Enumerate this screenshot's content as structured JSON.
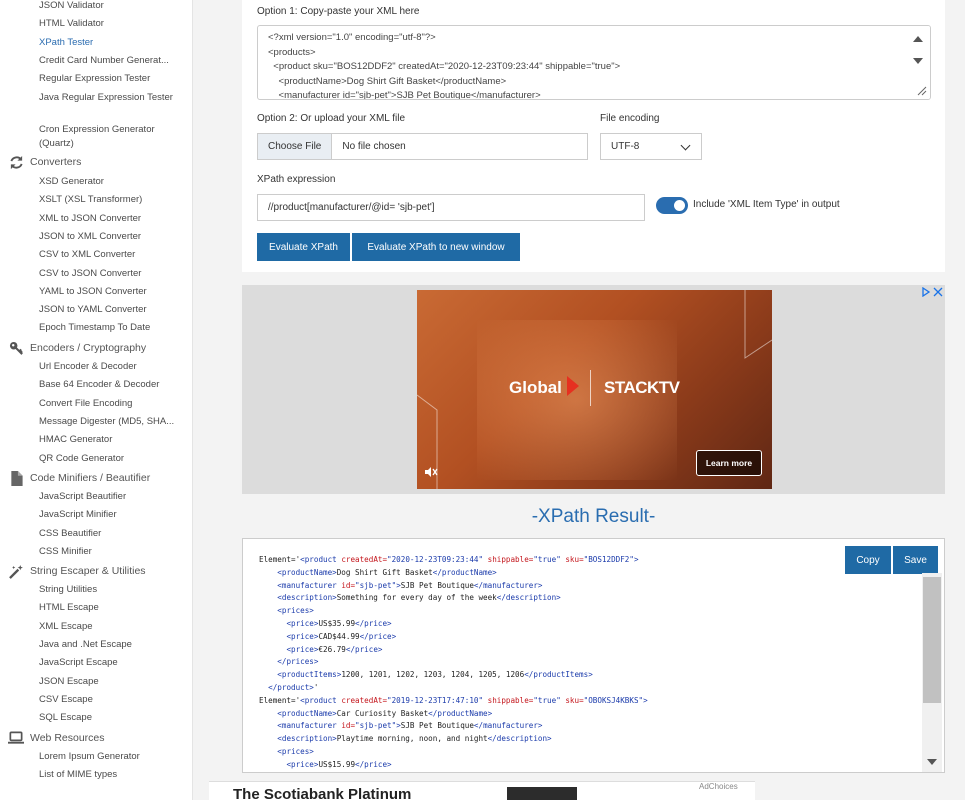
{
  "sidebar": {
    "links_top": [
      {
        "label": "JSON Validator",
        "active": false
      },
      {
        "label": "HTML Validator",
        "active": false
      },
      {
        "label": "XPath Tester",
        "active": true
      },
      {
        "label": "Credit Card Number Generat...",
        "active": false
      },
      {
        "label": "Regular Expression Tester",
        "active": false
      }
    ],
    "java_regex": "Java Regular Expression Tester",
    "cron": "Cron Expression Generator (Quartz)",
    "categories": {
      "converters": "Converters",
      "encoders": "Encoders / Cryptography",
      "minifiers": "Code Minifiers / Beautifier",
      "escaper": "String Escaper & Utilities",
      "web": "Web Resources"
    },
    "converters": [
      "XSD Generator",
      "XSLT (XSL Transformer)",
      "XML to JSON Converter",
      "JSON to XML Converter",
      "CSV to XML Converter",
      "CSV to JSON Converter",
      "YAML to JSON Converter",
      "JSON to YAML Converter",
      "Epoch Timestamp To Date"
    ],
    "encoders": [
      "Url Encoder & Decoder",
      "Base 64 Encoder & Decoder",
      "Convert File Encoding",
      "Message Digester (MD5, SHA...",
      "HMAC Generator",
      "QR Code Generator"
    ],
    "minifiers": [
      "JavaScript Beautifier",
      "JavaScript Minifier",
      "CSS Beautifier",
      "CSS Minifier"
    ],
    "escaper": [
      "String Utilities",
      "HTML Escape",
      "XML Escape",
      "Java and .Net Escape",
      "JavaScript Escape",
      "JSON Escape",
      "CSV Escape",
      "SQL Escape"
    ],
    "web": [
      "Lorem Ipsum Generator",
      "List of MIME types"
    ]
  },
  "form": {
    "option1_label": "Option 1: Copy-paste your XML here",
    "xml_lines": [
      "<?xml version=\"1.0\" encoding=\"utf-8\"?>",
      "<products>",
      "  <product sku=\"BOS12DDF2\" createdAt=\"2020-12-23T09:23:44\" shippable=\"true\">",
      "    <productName>Dog Shirt Gift Basket</productName>",
      "    <manufacturer id=\"sjb-pet\">SJB Pet Boutique</manufacturer>"
    ],
    "option2_label": "Option 2: Or upload your XML file",
    "choose_file": "Choose File",
    "no_file": "No file chosen",
    "encoding_label": "File encoding",
    "encoding_value": "UTF-8",
    "xpath_label": "XPath expression",
    "xpath_value": "//product[manufacturer/@id= 'sjb-pet']",
    "toggle_label": "Include 'XML Item Type' in output",
    "toggle_on": true,
    "evaluate_btn": "Evaluate XPath",
    "evaluate_new_btn": "Evaluate XPath to new window"
  },
  "ad": {
    "brand_left": "Global",
    "brand_right": "STACKTV",
    "learn_more": "Learn more"
  },
  "result": {
    "title": "-XPath Result-",
    "copy": "Copy",
    "save": "Save",
    "lines": [
      [
        [
          "t",
          "Element='"
        ],
        [
          "g",
          "<product "
        ],
        [
          "a",
          "createdAt="
        ],
        [
          "v",
          "\"2020-12-23T09:23:44\" "
        ],
        [
          "a",
          "shippable="
        ],
        [
          "v",
          "\"true\" "
        ],
        [
          "a",
          "sku="
        ],
        [
          "v",
          "\"BOS12DDF2\""
        ],
        [
          "g",
          ">"
        ]
      ],
      [
        [
          "t",
          "    "
        ],
        [
          "g",
          "<productName>"
        ],
        [
          "t",
          "Dog Shirt Gift Basket"
        ],
        [
          "g",
          "</productName>"
        ]
      ],
      [
        [
          "t",
          "    "
        ],
        [
          "g",
          "<manufacturer "
        ],
        [
          "a",
          "id="
        ],
        [
          "v",
          "\"sjb-pet\""
        ],
        [
          "g",
          ">"
        ],
        [
          "t",
          "SJB Pet Boutique"
        ],
        [
          "g",
          "</manufacturer>"
        ]
      ],
      [
        [
          "t",
          "    "
        ],
        [
          "g",
          "<description>"
        ],
        [
          "t",
          "Something for every day of the week"
        ],
        [
          "g",
          "</description>"
        ]
      ],
      [
        [
          "t",
          "    "
        ],
        [
          "g",
          "<prices>"
        ]
      ],
      [
        [
          "t",
          "      "
        ],
        [
          "g",
          "<price>"
        ],
        [
          "t",
          "US$35.99"
        ],
        [
          "g",
          "</price>"
        ]
      ],
      [
        [
          "t",
          "      "
        ],
        [
          "g",
          "<price>"
        ],
        [
          "t",
          "CAD$44.99"
        ],
        [
          "g",
          "</price>"
        ]
      ],
      [
        [
          "t",
          "      "
        ],
        [
          "g",
          "<price>"
        ],
        [
          "t",
          "€26.79"
        ],
        [
          "g",
          "</price>"
        ]
      ],
      [
        [
          "t",
          "    "
        ],
        [
          "g",
          "</prices>"
        ]
      ],
      [
        [
          "t",
          "    "
        ],
        [
          "g",
          "<productItems>"
        ],
        [
          "t",
          "1200, 1201, 1202, 1203, 1204, 1205, 1206"
        ],
        [
          "g",
          "</productItems>"
        ]
      ],
      [
        [
          "t",
          "  "
        ],
        [
          "g",
          "</product>"
        ],
        [
          "t",
          "'"
        ]
      ],
      [
        [
          "t",
          "Element='"
        ],
        [
          "g",
          "<product "
        ],
        [
          "a",
          "createdAt="
        ],
        [
          "v",
          "\"2019-12-23T17:47:10\" "
        ],
        [
          "a",
          "shippable="
        ],
        [
          "v",
          "\"true\" "
        ],
        [
          "a",
          "sku="
        ],
        [
          "v",
          "\"OBOKSJ4KBKS\""
        ],
        [
          "g",
          ">"
        ]
      ],
      [
        [
          "t",
          "    "
        ],
        [
          "g",
          "<productName>"
        ],
        [
          "t",
          "Car Curiosity Basket"
        ],
        [
          "g",
          "</productName>"
        ]
      ],
      [
        [
          "t",
          "    "
        ],
        [
          "g",
          "<manufacturer "
        ],
        [
          "a",
          "id="
        ],
        [
          "v",
          "\"sjb-pet\""
        ],
        [
          "g",
          ">"
        ],
        [
          "t",
          "SJB Pet Boutique"
        ],
        [
          "g",
          "</manufacturer>"
        ]
      ],
      [
        [
          "t",
          "    "
        ],
        [
          "g",
          "<description>"
        ],
        [
          "t",
          "Playtime morning, noon, and night"
        ],
        [
          "g",
          "</description>"
        ]
      ],
      [
        [
          "t",
          "    "
        ],
        [
          "g",
          "<prices>"
        ]
      ],
      [
        [
          "t",
          "      "
        ],
        [
          "g",
          "<price>"
        ],
        [
          "t",
          "US$15.99"
        ],
        [
          "g",
          "</price>"
        ]
      ]
    ]
  },
  "bottom_ad": {
    "text": "The Scotiabank Platinum",
    "adchoices": "AdChoices"
  }
}
